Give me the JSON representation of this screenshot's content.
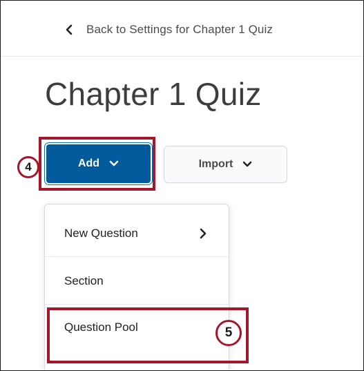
{
  "back_link": {
    "label": "Back to Settings for Chapter 1 Quiz",
    "icon": "chevron-left-icon"
  },
  "page": {
    "title": "Chapter 1 Quiz"
  },
  "toolbar": {
    "add_label": "Add",
    "import_label": "Import"
  },
  "steps": {
    "add_step": "4",
    "pool_step": "5"
  },
  "dropdown": {
    "items": [
      {
        "label": "New Question",
        "has_submenu": true
      },
      {
        "label": "Section",
        "has_submenu": false
      },
      {
        "label": "Question Pool",
        "has_submenu": false
      }
    ]
  },
  "colors": {
    "primary_button": "#005a9c",
    "highlight": "#a4162a",
    "secondary_button": "#f9fafb"
  }
}
